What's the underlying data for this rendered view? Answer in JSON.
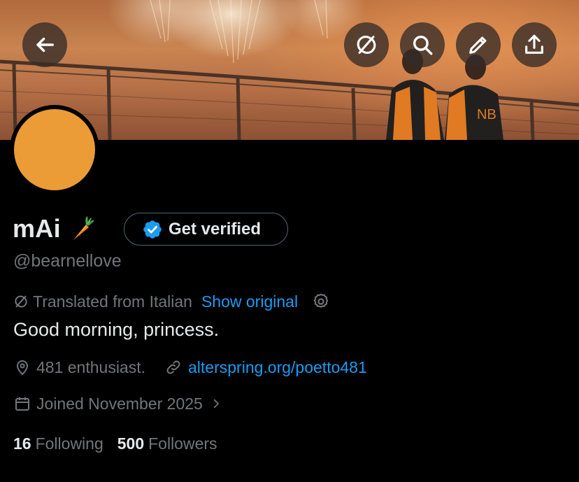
{
  "profile": {
    "display_name": "mAi",
    "name_emoji": "carrot-emoji",
    "handle": "@bearnellove",
    "verify_label": "Get verified",
    "avatar_color": "#eb9c36"
  },
  "translation": {
    "label": "Translated from Italian",
    "show_original": "Show original"
  },
  "bio": "Good morning, princess.",
  "meta": {
    "location": "481 enthusiast.",
    "website": "alterspring.org/poetto481",
    "joined": "Joined November 2025"
  },
  "stats": {
    "following_count": "16",
    "following_label": "Following",
    "followers_count": "500",
    "followers_label": "Followers"
  },
  "header_buttons": [
    "back-icon",
    "translate-icon",
    "search-icon",
    "edit-icon",
    "share-icon"
  ],
  "colors": {
    "accent_link": "#1d9bf0",
    "secondary_text": "#71767b",
    "primary_text": "#e7e9ea",
    "verified_badge": "#1d9bf0"
  }
}
